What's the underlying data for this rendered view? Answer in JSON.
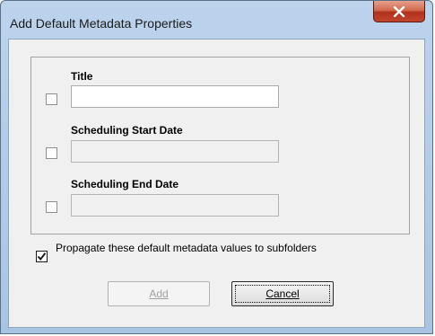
{
  "window": {
    "title": "Add Default Metadata Properties",
    "close_icon": "close-x-icon"
  },
  "fields": [
    {
      "label": "Title",
      "checked": false,
      "value": "",
      "enabled": true
    },
    {
      "label": "Scheduling Start Date",
      "checked": false,
      "value": "",
      "enabled": false
    },
    {
      "label": "Scheduling End Date",
      "checked": false,
      "value": "",
      "enabled": false
    }
  ],
  "propagate": {
    "checked": true,
    "label": "Propagate these default metadata values to subfolders"
  },
  "buttons": {
    "add_label": "Add",
    "add_enabled": false,
    "cancel_label": "Cancel"
  },
  "colors": {
    "frame": "#a9c4e2",
    "close_button": "#c2452d",
    "client_bg": "#f0f0f0"
  }
}
